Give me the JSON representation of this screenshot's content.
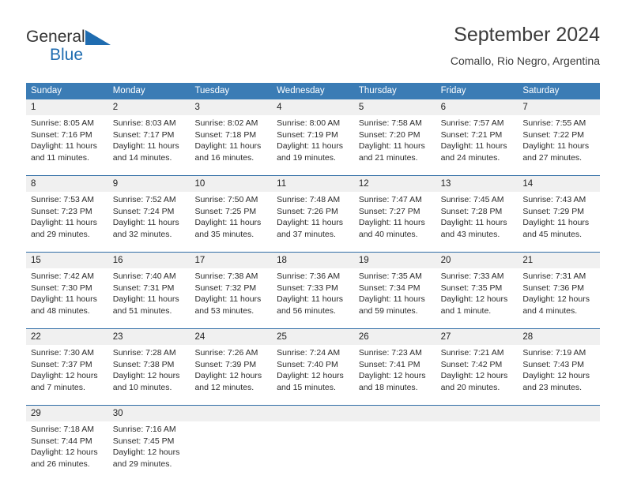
{
  "brand": {
    "name_top": "General",
    "name_bottom": "Blue",
    "triangle_icon": "blue-triangle-logo-mark",
    "color_primary": "#1f6cb0",
    "color_text": "#333333"
  },
  "header": {
    "title": "September 2024",
    "subtitle": "Comallo, Rio Negro, Argentina"
  },
  "theme": {
    "header_bg": "#3b7cb5",
    "header_text": "#ffffff",
    "day_number_bg": "#f0f0f0",
    "week_border": "#2f6ca5",
    "body_text": "#2b2b2b"
  },
  "weekdays": [
    "Sunday",
    "Monday",
    "Tuesday",
    "Wednesday",
    "Thursday",
    "Friday",
    "Saturday"
  ],
  "weeks": [
    {
      "days": [
        {
          "number": "1",
          "sunrise": "Sunrise: 8:05 AM",
          "sunset": "Sunset: 7:16 PM",
          "daylight_line1": "Daylight: 11 hours",
          "daylight_line2": "and 11 minutes."
        },
        {
          "number": "2",
          "sunrise": "Sunrise: 8:03 AM",
          "sunset": "Sunset: 7:17 PM",
          "daylight_line1": "Daylight: 11 hours",
          "daylight_line2": "and 14 minutes."
        },
        {
          "number": "3",
          "sunrise": "Sunrise: 8:02 AM",
          "sunset": "Sunset: 7:18 PM",
          "daylight_line1": "Daylight: 11 hours",
          "daylight_line2": "and 16 minutes."
        },
        {
          "number": "4",
          "sunrise": "Sunrise: 8:00 AM",
          "sunset": "Sunset: 7:19 PM",
          "daylight_line1": "Daylight: 11 hours",
          "daylight_line2": "and 19 minutes."
        },
        {
          "number": "5",
          "sunrise": "Sunrise: 7:58 AM",
          "sunset": "Sunset: 7:20 PM",
          "daylight_line1": "Daylight: 11 hours",
          "daylight_line2": "and 21 minutes."
        },
        {
          "number": "6",
          "sunrise": "Sunrise: 7:57 AM",
          "sunset": "Sunset: 7:21 PM",
          "daylight_line1": "Daylight: 11 hours",
          "daylight_line2": "and 24 minutes."
        },
        {
          "number": "7",
          "sunrise": "Sunrise: 7:55 AM",
          "sunset": "Sunset: 7:22 PM",
          "daylight_line1": "Daylight: 11 hours",
          "daylight_line2": "and 27 minutes."
        }
      ]
    },
    {
      "days": [
        {
          "number": "8",
          "sunrise": "Sunrise: 7:53 AM",
          "sunset": "Sunset: 7:23 PM",
          "daylight_line1": "Daylight: 11 hours",
          "daylight_line2": "and 29 minutes."
        },
        {
          "number": "9",
          "sunrise": "Sunrise: 7:52 AM",
          "sunset": "Sunset: 7:24 PM",
          "daylight_line1": "Daylight: 11 hours",
          "daylight_line2": "and 32 minutes."
        },
        {
          "number": "10",
          "sunrise": "Sunrise: 7:50 AM",
          "sunset": "Sunset: 7:25 PM",
          "daylight_line1": "Daylight: 11 hours",
          "daylight_line2": "and 35 minutes."
        },
        {
          "number": "11",
          "sunrise": "Sunrise: 7:48 AM",
          "sunset": "Sunset: 7:26 PM",
          "daylight_line1": "Daylight: 11 hours",
          "daylight_line2": "and 37 minutes."
        },
        {
          "number": "12",
          "sunrise": "Sunrise: 7:47 AM",
          "sunset": "Sunset: 7:27 PM",
          "daylight_line1": "Daylight: 11 hours",
          "daylight_line2": "and 40 minutes."
        },
        {
          "number": "13",
          "sunrise": "Sunrise: 7:45 AM",
          "sunset": "Sunset: 7:28 PM",
          "daylight_line1": "Daylight: 11 hours",
          "daylight_line2": "and 43 minutes."
        },
        {
          "number": "14",
          "sunrise": "Sunrise: 7:43 AM",
          "sunset": "Sunset: 7:29 PM",
          "daylight_line1": "Daylight: 11 hours",
          "daylight_line2": "and 45 minutes."
        }
      ]
    },
    {
      "days": [
        {
          "number": "15",
          "sunrise": "Sunrise: 7:42 AM",
          "sunset": "Sunset: 7:30 PM",
          "daylight_line1": "Daylight: 11 hours",
          "daylight_line2": "and 48 minutes."
        },
        {
          "number": "16",
          "sunrise": "Sunrise: 7:40 AM",
          "sunset": "Sunset: 7:31 PM",
          "daylight_line1": "Daylight: 11 hours",
          "daylight_line2": "and 51 minutes."
        },
        {
          "number": "17",
          "sunrise": "Sunrise: 7:38 AM",
          "sunset": "Sunset: 7:32 PM",
          "daylight_line1": "Daylight: 11 hours",
          "daylight_line2": "and 53 minutes."
        },
        {
          "number": "18",
          "sunrise": "Sunrise: 7:36 AM",
          "sunset": "Sunset: 7:33 PM",
          "daylight_line1": "Daylight: 11 hours",
          "daylight_line2": "and 56 minutes."
        },
        {
          "number": "19",
          "sunrise": "Sunrise: 7:35 AM",
          "sunset": "Sunset: 7:34 PM",
          "daylight_line1": "Daylight: 11 hours",
          "daylight_line2": "and 59 minutes."
        },
        {
          "number": "20",
          "sunrise": "Sunrise: 7:33 AM",
          "sunset": "Sunset: 7:35 PM",
          "daylight_line1": "Daylight: 12 hours",
          "daylight_line2": "and 1 minute."
        },
        {
          "number": "21",
          "sunrise": "Sunrise: 7:31 AM",
          "sunset": "Sunset: 7:36 PM",
          "daylight_line1": "Daylight: 12 hours",
          "daylight_line2": "and 4 minutes."
        }
      ]
    },
    {
      "days": [
        {
          "number": "22",
          "sunrise": "Sunrise: 7:30 AM",
          "sunset": "Sunset: 7:37 PM",
          "daylight_line1": "Daylight: 12 hours",
          "daylight_line2": "and 7 minutes."
        },
        {
          "number": "23",
          "sunrise": "Sunrise: 7:28 AM",
          "sunset": "Sunset: 7:38 PM",
          "daylight_line1": "Daylight: 12 hours",
          "daylight_line2": "and 10 minutes."
        },
        {
          "number": "24",
          "sunrise": "Sunrise: 7:26 AM",
          "sunset": "Sunset: 7:39 PM",
          "daylight_line1": "Daylight: 12 hours",
          "daylight_line2": "and 12 minutes."
        },
        {
          "number": "25",
          "sunrise": "Sunrise: 7:24 AM",
          "sunset": "Sunset: 7:40 PM",
          "daylight_line1": "Daylight: 12 hours",
          "daylight_line2": "and 15 minutes."
        },
        {
          "number": "26",
          "sunrise": "Sunrise: 7:23 AM",
          "sunset": "Sunset: 7:41 PM",
          "daylight_line1": "Daylight: 12 hours",
          "daylight_line2": "and 18 minutes."
        },
        {
          "number": "27",
          "sunrise": "Sunrise: 7:21 AM",
          "sunset": "Sunset: 7:42 PM",
          "daylight_line1": "Daylight: 12 hours",
          "daylight_line2": "and 20 minutes."
        },
        {
          "number": "28",
          "sunrise": "Sunrise: 7:19 AM",
          "sunset": "Sunset: 7:43 PM",
          "daylight_line1": "Daylight: 12 hours",
          "daylight_line2": "and 23 minutes."
        }
      ]
    },
    {
      "days": [
        {
          "number": "29",
          "sunrise": "Sunrise: 7:18 AM",
          "sunset": "Sunset: 7:44 PM",
          "daylight_line1": "Daylight: 12 hours",
          "daylight_line2": "and 26 minutes."
        },
        {
          "number": "30",
          "sunrise": "Sunrise: 7:16 AM",
          "sunset": "Sunset: 7:45 PM",
          "daylight_line1": "Daylight: 12 hours",
          "daylight_line2": "and 29 minutes."
        },
        {
          "number": "",
          "sunrise": "",
          "sunset": "",
          "daylight_line1": "",
          "daylight_line2": ""
        },
        {
          "number": "",
          "sunrise": "",
          "sunset": "",
          "daylight_line1": "",
          "daylight_line2": ""
        },
        {
          "number": "",
          "sunrise": "",
          "sunset": "",
          "daylight_line1": "",
          "daylight_line2": ""
        },
        {
          "number": "",
          "sunrise": "",
          "sunset": "",
          "daylight_line1": "",
          "daylight_line2": ""
        },
        {
          "number": "",
          "sunrise": "",
          "sunset": "",
          "daylight_line1": "",
          "daylight_line2": ""
        }
      ]
    }
  ]
}
